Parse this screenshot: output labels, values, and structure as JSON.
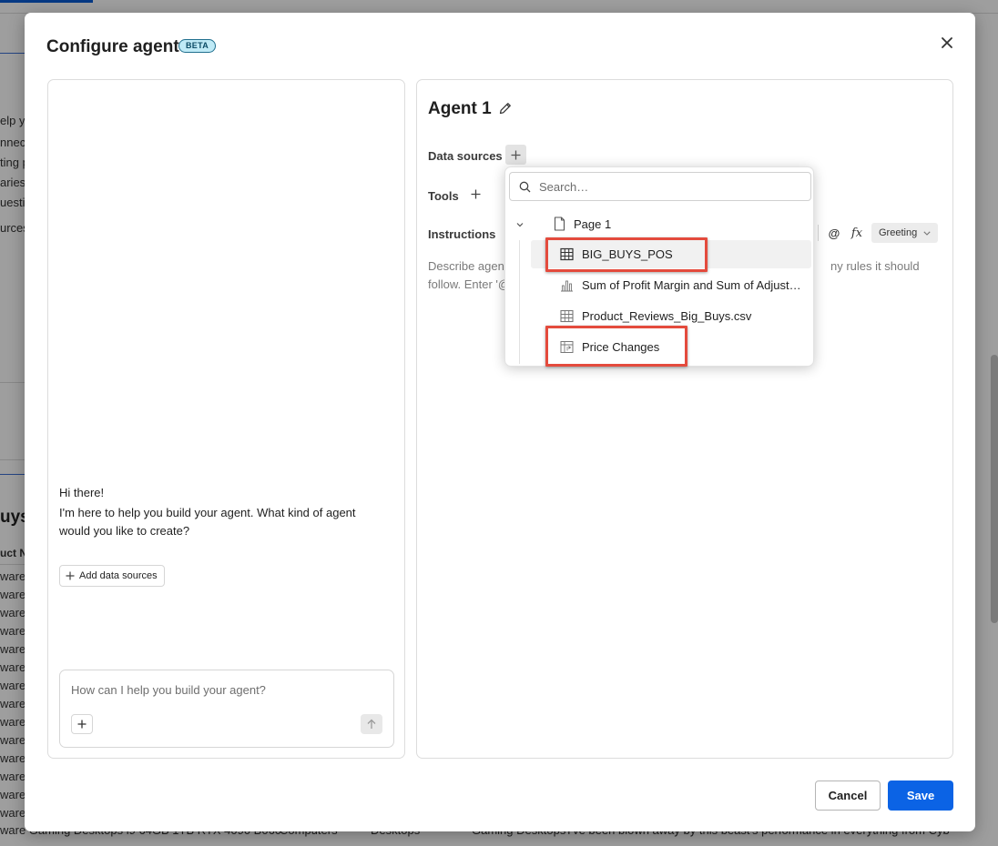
{
  "background": {
    "fragments": [
      "elp y",
      "nnect",
      "ting p",
      "aries",
      "uestic",
      "urces"
    ],
    "heading": "uys",
    "column_fragment": "uct N",
    "row_fragment": "ware",
    "footer_row": [
      "ware Gaming Desktops i9 64GB 1TB RTX 4090 B060",
      "Computers",
      "Desktops",
      "Gaming Desktops",
      "I've been blown away by this beast's performance in everything from Cyberp..."
    ]
  },
  "modal": {
    "title": "Configure agent",
    "badge": "BETA",
    "close_icon": "close-icon"
  },
  "chat": {
    "greeting": "Hi there!",
    "message": "I'm here to help you build your agent. What kind of agent would you like to create?",
    "add_data_sources": "Add data sources",
    "input_placeholder": "How can I help you build your agent?"
  },
  "agent": {
    "name": "Agent 1",
    "data_sources_label": "Data sources",
    "tools_label": "Tools",
    "instructions_label": "Instructions",
    "at_symbol": "@",
    "fx_symbol": "fx",
    "greeting_button": "Greeting",
    "instructions_placeholder_left_1": "Describe agent",
    "instructions_placeholder_left_2": "follow. Enter '@",
    "instructions_placeholder_right": "ny rules it should"
  },
  "dropdown": {
    "search_placeholder": "Search…",
    "page": "Page 1",
    "items": [
      {
        "label": "BIG_BUYS_POS",
        "icon": "table-icon"
      },
      {
        "label": "Sum of Profit Margin and Sum of Adjusted Price",
        "icon": "bar-chart-icon"
      },
      {
        "label": "Product_Reviews_Big_Buys.csv",
        "icon": "table-icon"
      },
      {
        "label": "Price Changes",
        "icon": "pivot-table-icon"
      }
    ]
  },
  "footer": {
    "cancel": "Cancel",
    "save": "Save"
  },
  "colors": {
    "primary": "#0b63e5",
    "highlight": "#e44b3d",
    "badge_bg": "#bfeaf6"
  }
}
